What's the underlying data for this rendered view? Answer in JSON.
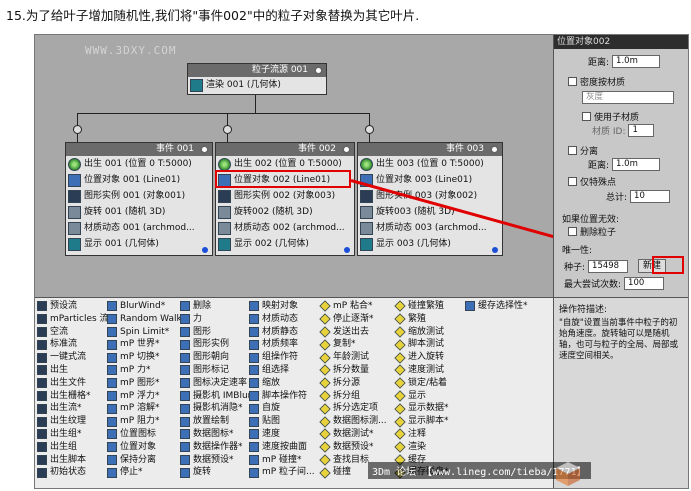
{
  "caption": "15.为了给叶子增加随机性,我们将\"事件002\"中的粒子对象替换为其它叶片.",
  "watermark": "WWW.3DXY.COM",
  "source": {
    "title": "粒子流源 001",
    "op": "渲染 001 (几何体)"
  },
  "events": [
    {
      "title": "事件 001",
      "ops": [
        "出生 001 (位置 0 T:5000)",
        "位置对象 001 (Line01)",
        "图形实例 001 (对象001)",
        "旋转 001 (随机 3D)",
        "材质动态 001 (archmod...",
        "显示 001 (几何体)"
      ]
    },
    {
      "title": "事件 002",
      "ops": [
        "出生 002 (位置 0 T:5000)",
        "位置对象 002 (Line01)",
        "图形实例 002 (对象003)",
        "旋转002 (随机 3D)",
        "材质动态 002 (archmod...",
        "显示 002 (几何体)"
      ]
    },
    {
      "title": "事件 003",
      "ops": [
        "出生 003 (位置 0 T:5000)",
        "位置对象 003 (Line01)",
        "图形实例 003 (对象002)",
        "旋转003 (随机 3D)",
        "材质动态 003 (archmod...",
        "显示 003 (几何体)"
      ]
    }
  ],
  "panel": {
    "header": "位置对象002",
    "dist_label": "距离:",
    "dist_value1": "1.0m",
    "density_label": "密度按材质",
    "gray_value": "灰度",
    "use_submtl": "使用子材质",
    "mtl_id_label": "材质 ID:",
    "mtl_id_value": "1",
    "separate_label": "分离",
    "dist_value2": "1.0m",
    "vertices_label": "仅特殊点",
    "total_label": "总计:",
    "total_value": "10",
    "invalid_label": "如果位置无效:",
    "delete_label": "删除粒子",
    "unique_label": "唯一性:",
    "seed_label": "种子:",
    "seed_value": "15498",
    "new_button": "新建",
    "attempts_label": "最大尝试次数:",
    "attempts_value": "100"
  },
  "depot": {
    "col1": [
      "预设流",
      "mParticles 流*",
      "空流",
      "标准流",
      "一键式流",
      "出生",
      "出生文件",
      "出生栅格*",
      "出生流*",
      "出生纹理",
      "出生组*",
      "出生组",
      "出生脚本",
      "初始状态"
    ],
    "col2": [
      "BlurWind*",
      "Random Walk*",
      "Spin Limit*",
      "mP 世界*",
      "mP 切换*",
      "mP 力*",
      "mP 图形*",
      "mP 浮力*",
      "mP 溶解*",
      "mP 阻力*",
      "位置图标",
      "位置对象",
      "保持分离",
      "停止*"
    ],
    "col3": [
      "删除",
      "力",
      "图形",
      "图形实例",
      "图形朝向",
      "图形标记",
      "图标决定速率",
      "摄影机 IMBlur*",
      "摄影机消隐*",
      "放置绘制",
      "数据图标*",
      "数据操作器*",
      "数据预设*",
      "旋转"
    ],
    "col4": [
      "映射对象",
      "材质动态",
      "材质静态",
      "材质频率",
      "组操作符",
      "组选择",
      "缩放",
      "脚本操作符",
      "自旋",
      "贴图",
      "速度",
      "速度按曲面",
      "mP 碰撞*",
      "mP 粒子间..."
    ],
    "col5": [
      "mP 粘合*",
      "停止逐渐*",
      "发送出去",
      "复制*",
      "年龄测试",
      "拆分数量",
      "拆分源",
      "拆分组",
      "拆分选定项",
      "数据图标测...",
      "数据测试*",
      "数据预设*",
      "查找目标",
      "碰撞"
    ],
    "col6": [
      "碰撞繁殖",
      "繁殖",
      "缩放测试",
      "脚本测试",
      "进入旋转",
      "速度测试",
      "锁定/粘着",
      "显示",
      "显示数据*",
      "显示脚本*",
      "注释",
      "渲染",
      "缓存",
      "缓存磁盘*"
    ],
    "col7": [
      "缓存选择性*"
    ]
  },
  "desc": {
    "title": "操作符描述:",
    "body": "\"自旋\"设置当前事件中粒子的初始角速度。旋转轴可以是随机轴，也可与粒子的全局、局部或速度空间相关。"
  },
  "footer": "3Dm 论坛 【www.lineg.com/tieba/1771】"
}
